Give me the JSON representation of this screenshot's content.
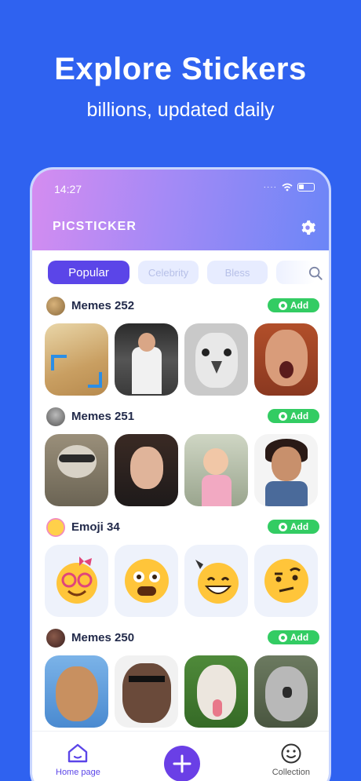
{
  "promo": {
    "title": "Explore Stickers",
    "subtitle": "billions, updated daily"
  },
  "status": {
    "time": "14:27"
  },
  "app": {
    "name": "PICSTICKER"
  },
  "tabs": [
    {
      "label": "Popular",
      "active": true
    },
    {
      "label": "Celebrity",
      "active": false
    },
    {
      "label": "Bless",
      "active": false
    }
  ],
  "sections": [
    {
      "title": "Memes 252",
      "add_label": "Add"
    },
    {
      "title": "Memes 251",
      "add_label": "Add"
    },
    {
      "title": "Emoji 34",
      "add_label": "Add"
    },
    {
      "title": "Memes 250",
      "add_label": "Add"
    }
  ],
  "nav": {
    "home_label": "Home page",
    "collection_label": "Collection"
  },
  "colors": {
    "background": "#2f62f0",
    "accent": "#5b45e8",
    "add_green": "#33cc63"
  }
}
